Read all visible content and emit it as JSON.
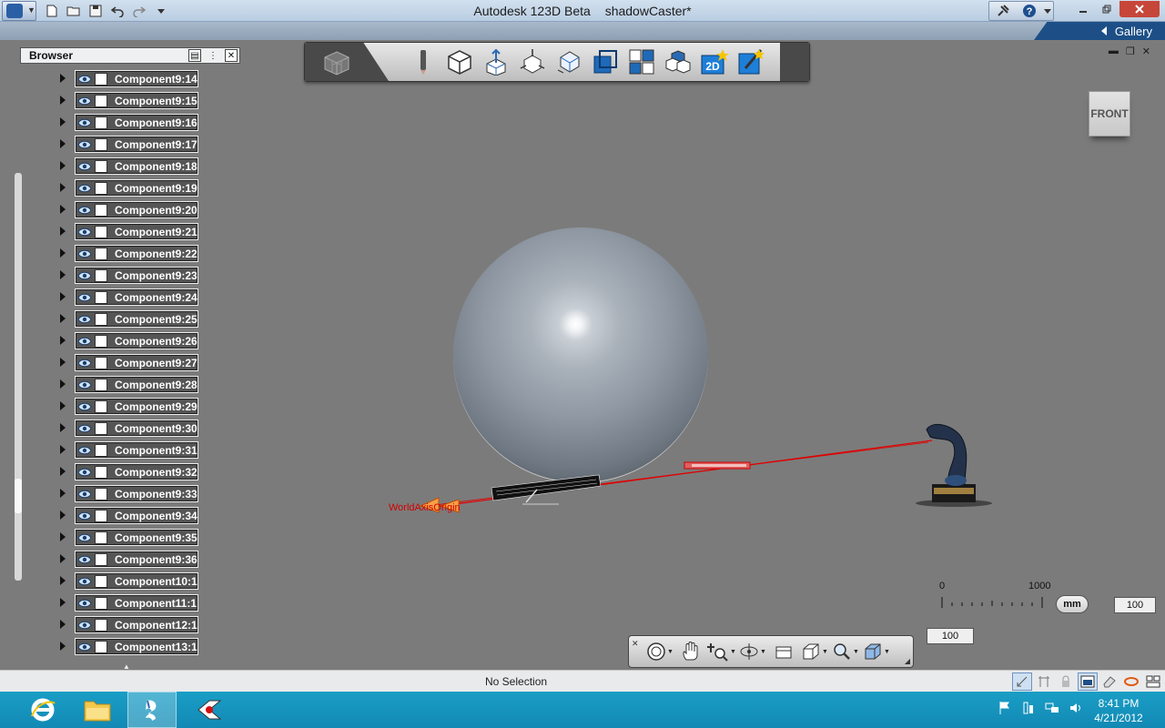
{
  "window": {
    "app_name": "Autodesk 123D Beta",
    "document_name": "shadowCaster*"
  },
  "gallery": {
    "label": "Gallery"
  },
  "browser": {
    "title": "Browser",
    "items": [
      {
        "label": "Component9:14"
      },
      {
        "label": "Component9:15"
      },
      {
        "label": "Component9:16"
      },
      {
        "label": "Component9:17"
      },
      {
        "label": "Component9:18"
      },
      {
        "label": "Component9:19"
      },
      {
        "label": "Component9:20"
      },
      {
        "label": "Component9:21"
      },
      {
        "label": "Component9:22"
      },
      {
        "label": "Component9:23"
      },
      {
        "label": "Component9:24"
      },
      {
        "label": "Component9:25"
      },
      {
        "label": "Component9:26"
      },
      {
        "label": "Component9:27"
      },
      {
        "label": "Component9:28"
      },
      {
        "label": "Component9:29"
      },
      {
        "label": "Component9:30"
      },
      {
        "label": "Component9:31"
      },
      {
        "label": "Component9:32"
      },
      {
        "label": "Component9:33"
      },
      {
        "label": "Component9:34"
      },
      {
        "label": "Component9:35"
      },
      {
        "label": "Component9:36"
      },
      {
        "label": "Component10:1"
      },
      {
        "label": "Component11:1"
      },
      {
        "label": "Component12:1"
      },
      {
        "label": "Component13:1"
      }
    ]
  },
  "toolbar": {
    "icons": [
      "pencil-icon",
      "primitive-box-icon",
      "construct-icon",
      "modify-icon",
      "pattern-icon",
      "group-icon",
      "grid-icon",
      "materials-icon",
      "sketch-2d-icon",
      "snap-icon"
    ],
    "sketch_2d_label": "2D"
  },
  "viewcube": {
    "face": "FRONT"
  },
  "scene": {
    "label": "WorldAxisOrigin"
  },
  "scale": {
    "min": "0",
    "max": "1000",
    "unit": "mm",
    "grid_value": "100",
    "snap_value": "100"
  },
  "status": {
    "text": "No Selection"
  },
  "clock": {
    "time": "8:41 PM",
    "date": "4/21/2012"
  },
  "colors": {
    "accent": "#1d4f86",
    "taskbar": "#1a9ec6",
    "laser": "#e00000"
  }
}
